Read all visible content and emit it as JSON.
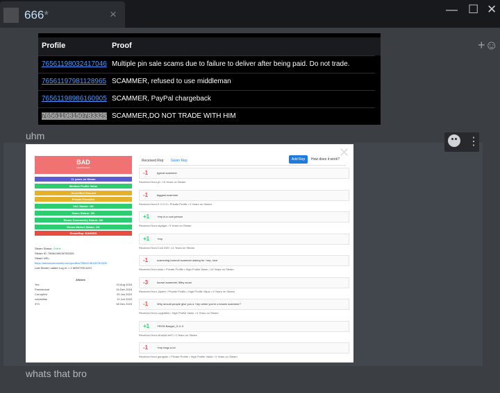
{
  "window": {
    "title": "666",
    "tab_modified": "*",
    "close_tab": "×",
    "minimize": "—",
    "maximize": "☐",
    "close": "✕"
  },
  "table": {
    "headers": [
      "Profile",
      "Proof"
    ],
    "rows": [
      {
        "profile": "76561198032417046",
        "proof": "Multiple pin sale scams due to failure to deliver after being paid. Do not trade."
      },
      {
        "profile": "76561197981128965",
        "proof": "SCAMMER, refused to use middleman"
      },
      {
        "profile": "76561198986160905",
        "proof": "SCAMMER, PayPal chargeback"
      },
      {
        "profile": "76561198150783325",
        "proof": "SCAMMER,DO NOT TRADE WITH HIM"
      }
    ]
  },
  "messages": {
    "msg1": "uhm",
    "msg2": "whats that bro"
  },
  "image": {
    "bad_title": "BAD",
    "bad_sub": "REPUTATION",
    "pills": [
      {
        "label": "11 years on Steam",
        "color": "#5b5bd6"
      },
      {
        "label": "Medium Profile Value",
        "color": "#2ecc71"
      },
      {
        "label": "Unverified Discord",
        "color": "#e3b12b"
      },
      {
        "label": "Private Friendlist",
        "color": "#e3b12b"
      },
      {
        "label": "VAC Status: OK",
        "color": "#2ecc71"
      },
      {
        "label": "Game Status: OK",
        "color": "#2ecc71"
      },
      {
        "label": "Steam Community Status: OK",
        "color": "#2ecc71"
      },
      {
        "label": "Steam Market Status: OK",
        "color": "#2ecc71"
      },
      {
        "label": "SteamRep: BANNED",
        "color": "#e74c3c"
      }
    ],
    "status": {
      "steam_status_label": "Steam Status:",
      "steam_status": "Online",
      "steam_id": "Steam ID: 76561198150783325",
      "steam_url_label": "Steam URL:",
      "steam_url": "https://steamcommunity.com/profiles/76561198150783325/",
      "last_login": "Last Steam Ladder Log in: > 2 MONTHS AGO"
    },
    "aliases_title": "Aliases",
    "aliases": [
      {
        "name": "Yes",
        "date": "24 Aug 2018"
      },
      {
        "name": "Paradoxical",
        "date": "24 Dec 2018"
      },
      {
        "name": "Corrupted",
        "date": "29 Jan 2020"
      },
      {
        "name": "corpsellas",
        "date": "11 Jun 2020"
      },
      {
        "name": "373",
        "date": "08 Dec 2023"
      }
    ],
    "tab_received": "Received Rep",
    "tab_given": "Given Rep",
    "add_rep": "Add Rep",
    "how": "How does it work?",
    "reps": [
      {
        "score": "-1",
        "comment": "typical scammer",
        "from": "Received from jd • 15 Years on Steam",
        "color": "#e74c3c"
      },
      {
        "score": "-1",
        "comment": "biggest scammer",
        "from": "Received from K O H 3 • Private Profile • 9 Years on Steam",
        "color": "#e74c3c"
      },
      {
        "score": "+1",
        "comment": "+rep is a cool person",
        "from": "Received from skylight • 9 Years on Steam",
        "color": "#2ecc71"
      },
      {
        "score": "+1",
        "comment": "+rep",
        "from": "Received from Cool 453 • 11 Years on Steam",
        "color": "#2ecc71"
      },
      {
        "score": "-1",
        "comment": "scamming bumroll scammer asking for +rep, nice",
        "from": "Received from tolas • Private Profile • High Profile Value • 14 Years on Steam",
        "color": "#e74c3c"
      },
      {
        "score": "-3",
        "comment": "known scammer, filthy scum",
        "from": "Received from Jupiter • Private Profile • High Profile Value • 9 Years on Steam",
        "color": "#e74c3c"
      },
      {
        "score": "-1",
        "comment": "Why should people give you a +rep when you're a known scammer?",
        "from": "Received from LoginMist • High Profile Value • 9 Years on Steam",
        "color": "#e74c3c"
      },
      {
        "score": "+1",
        "comment": "YRGN Bazgot_G-X-3",
        "from": "Received from sKeAaCeeS • 9 Years on Steam",
        "color": "#2ecc71"
      },
      {
        "score": "-1",
        "comment": "+rep begs a lot",
        "from": "Received from gangster • Private Profile • High Profile Value • 9 Years on Steam",
        "color": "#e74c3c"
      }
    ]
  }
}
